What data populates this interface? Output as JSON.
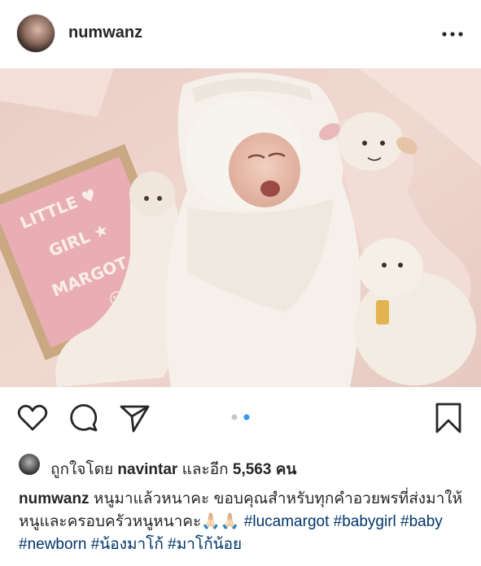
{
  "post": {
    "username": "numwanz",
    "image_alt": "Newborn baby yawning, swaddled in white blanket with lamb plush toys and a pink letter board reading LITTLE GIRL MARGOT",
    "letterboard": [
      "LITTLE ♥",
      "GIRL ★",
      "MARGOT",
      "☺"
    ]
  },
  "carousel": {
    "count": 2,
    "active_index": 1
  },
  "likes": {
    "prefix": "ถูกใจโดย",
    "user": "navintar",
    "middle": "และอีก",
    "count": "5,563",
    "suffix": "คน"
  },
  "caption": {
    "username": "numwanz",
    "text": "หนูมาแล้วหนาคะ ขอบคุณสำหรับทุกคำอวยพรที่ส่งมาให้หนูและครอบครัวหนูหนาคะ🙏🏻🙏🏻",
    "hashtags": [
      "#lucamargot",
      "#babygirl",
      "#baby",
      "#newborn",
      "#น้องมาโก้",
      "#มาโก้น้อย"
    ]
  },
  "colors": {
    "link": "#003569",
    "active_dot": "#3897f0",
    "inactive_dot": "#c7c7c7"
  }
}
